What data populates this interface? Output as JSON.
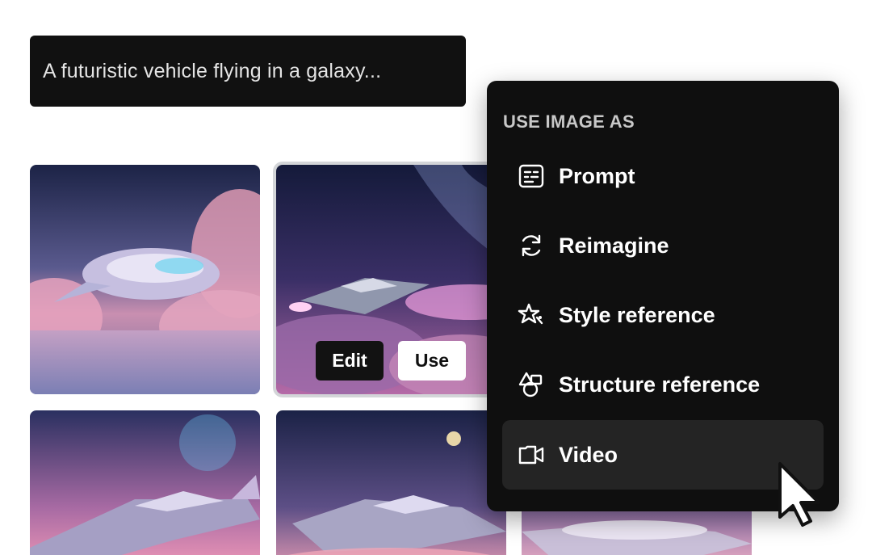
{
  "prompt": {
    "text": "A futuristic vehicle flying in a galaxy..."
  },
  "tile_actions": {
    "edit_label": "Edit",
    "use_label": "Use"
  },
  "menu": {
    "heading": "USE IMAGE AS",
    "items": [
      {
        "label": "Prompt",
        "icon": "prompt-icon"
      },
      {
        "label": "Reimagine",
        "icon": "reimagine-icon"
      },
      {
        "label": "Style reference",
        "icon": "style-reference-icon"
      },
      {
        "label": "Structure reference",
        "icon": "structure-reference-icon"
      },
      {
        "label": "Video",
        "icon": "video-icon"
      }
    ],
    "hovered_item": "Video"
  },
  "colors": {
    "menu_bg": "#0f0f0f",
    "menu_hover": "#242424",
    "prompt_bg": "#111111",
    "selection_ring": "#d3d5d8"
  }
}
